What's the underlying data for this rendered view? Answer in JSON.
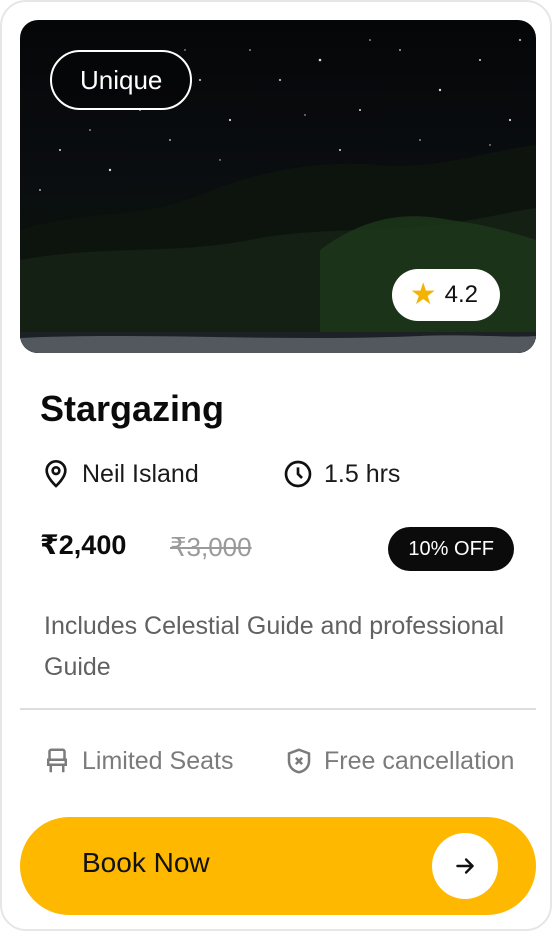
{
  "card": {
    "tag": "Unique",
    "rating": "4.2",
    "title": "Stargazing",
    "location": "Neil Island",
    "duration": "1.5 hrs",
    "price": "₹2,400",
    "original_price": "₹3,000",
    "discount": "10% OFF",
    "description": "Includes Celestial Guide and professional Guide",
    "features": {
      "seats": "Limited Seats",
      "cancellation": "Free cancellation"
    },
    "cta": "Book Now"
  },
  "icons": {
    "location": "map-pin-icon",
    "duration": "clock-icon",
    "rating": "star-icon",
    "seats": "seat-icon",
    "cancellation": "shield-x-icon",
    "cta": "arrow-right-icon"
  },
  "colors": {
    "accent": "#ffb800",
    "star": "#f2b400",
    "badge": "#0b0b0b"
  }
}
